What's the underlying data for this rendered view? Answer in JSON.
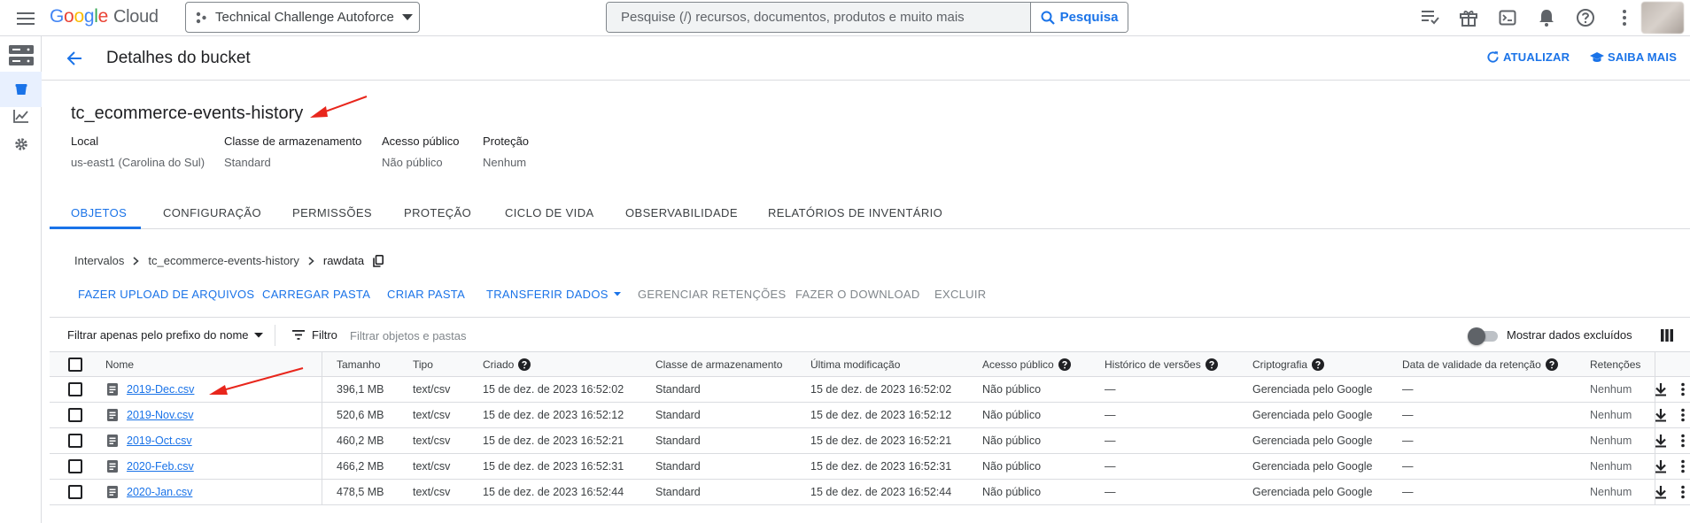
{
  "topbar": {
    "logo_google": [
      "G",
      "o",
      "o",
      "g",
      "l",
      "e"
    ],
    "logo_colors": [
      "#4285F4",
      "#EA4335",
      "#FBBC05",
      "#4285F4",
      "#34A853",
      "#EA4335"
    ],
    "logo_cloud": "Cloud",
    "project": "Technical Challenge Autoforce",
    "search_placeholder": "Pesquise (/) recursos, documentos, produtos e muito mais",
    "search_button": "Pesquisa"
  },
  "header": {
    "title": "Detalhes do bucket",
    "refresh": "ATUALIZAR",
    "learn_more": "SAIBA MAIS"
  },
  "bucket": {
    "name": "tc_ecommerce-events-history",
    "meta": [
      {
        "key": "Local",
        "value": "us-east1 (Carolina do Sul)"
      },
      {
        "key": "Classe de armazenamento",
        "value": "Standard"
      },
      {
        "key": "Acesso público",
        "value": "Não público"
      },
      {
        "key": "Proteção",
        "value": "Nenhum"
      }
    ]
  },
  "tabs": [
    "OBJETOS",
    "CONFIGURAÇÃO",
    "PERMISSÕES",
    "PROTEÇÃO",
    "CICLO DE VIDA",
    "OBSERVABILIDADE",
    "RELATÓRIOS DE INVENTÁRIO"
  ],
  "breadcrumb": [
    "Intervalos",
    "tc_ecommerce-events-history",
    "rawdata"
  ],
  "actions": {
    "upload_files": "FAZER UPLOAD DE ARQUIVOS",
    "upload_folder": "CARREGAR PASTA",
    "create_folder": "CRIAR PASTA",
    "transfer": "TRANSFERIR DADOS",
    "holds": "GERENCIAR RETENÇÕES",
    "download": "FAZER O DOWNLOAD",
    "delete": "EXCLUIR"
  },
  "filter": {
    "prefix": "Filtrar apenas pelo prefixo do nome",
    "label": "Filtro",
    "placeholder": "Filtrar objetos e pastas",
    "show_deleted": "Mostrar dados excluídos"
  },
  "table": {
    "columns": [
      "Nome",
      "Tamanho",
      "Tipo",
      "Criado",
      "Classe de armazenamento",
      "Última modificação",
      "Acesso público",
      "Histórico de versões",
      "Criptografia",
      "Data de validade da retenção",
      "Retenções"
    ],
    "rows": [
      {
        "name": "2019-Dec.csv",
        "size": "396,1 MB",
        "type": "text/csv",
        "created": "15 de dez. de 2023 16:52:02",
        "class": "Standard",
        "modified": "15 de dez. de 2023 16:52:02",
        "access": "Não público",
        "versions": "—",
        "encryption": "Gerenciada pelo Google",
        "retention_date": "—",
        "holds": "Nenhum"
      },
      {
        "name": "2019-Nov.csv",
        "size": "520,6 MB",
        "type": "text/csv",
        "created": "15 de dez. de 2023 16:52:12",
        "class": "Standard",
        "modified": "15 de dez. de 2023 16:52:12",
        "access": "Não público",
        "versions": "—",
        "encryption": "Gerenciada pelo Google",
        "retention_date": "—",
        "holds": "Nenhum"
      },
      {
        "name": "2019-Oct.csv",
        "size": "460,2 MB",
        "type": "text/csv",
        "created": "15 de dez. de 2023 16:52:21",
        "class": "Standard",
        "modified": "15 de dez. de 2023 16:52:21",
        "access": "Não público",
        "versions": "—",
        "encryption": "Gerenciada pelo Google",
        "retention_date": "—",
        "holds": "Nenhum"
      },
      {
        "name": "2020-Feb.csv",
        "size": "466,2 MB",
        "type": "text/csv",
        "created": "15 de dez. de 2023 16:52:31",
        "class": "Standard",
        "modified": "15 de dez. de 2023 16:52:31",
        "access": "Não público",
        "versions": "—",
        "encryption": "Gerenciada pelo Google",
        "retention_date": "—",
        "holds": "Nenhum"
      },
      {
        "name": "2020-Jan.csv",
        "size": "478,5 MB",
        "type": "text/csv",
        "created": "15 de dez. de 2023 16:52:44",
        "class": "Standard",
        "modified": "15 de dez. de 2023 16:52:44",
        "access": "Não público",
        "versions": "—",
        "encryption": "Gerenciada pelo Google",
        "retention_date": "—",
        "holds": "Nenhum"
      }
    ]
  },
  "icons": {
    "menu": "menu-icon",
    "project": "project-dots-icon",
    "search": "search-icon",
    "notes": "release-notes-icon",
    "gift": "gift-icon",
    "shell": "cloud-shell-icon",
    "bell": "bell-icon",
    "help": "help-icon",
    "more": "more-vert-icon",
    "back": "arrow-back-icon",
    "refresh": "refresh-icon",
    "school": "school-icon",
    "file": "file-icon",
    "download": "download-icon",
    "filter": "filter-icon",
    "columns": "columns-icon",
    "copy": "copy-icon"
  },
  "colors": {
    "accent": "#1a73e8",
    "annotation_arrow": "#e8261c"
  }
}
